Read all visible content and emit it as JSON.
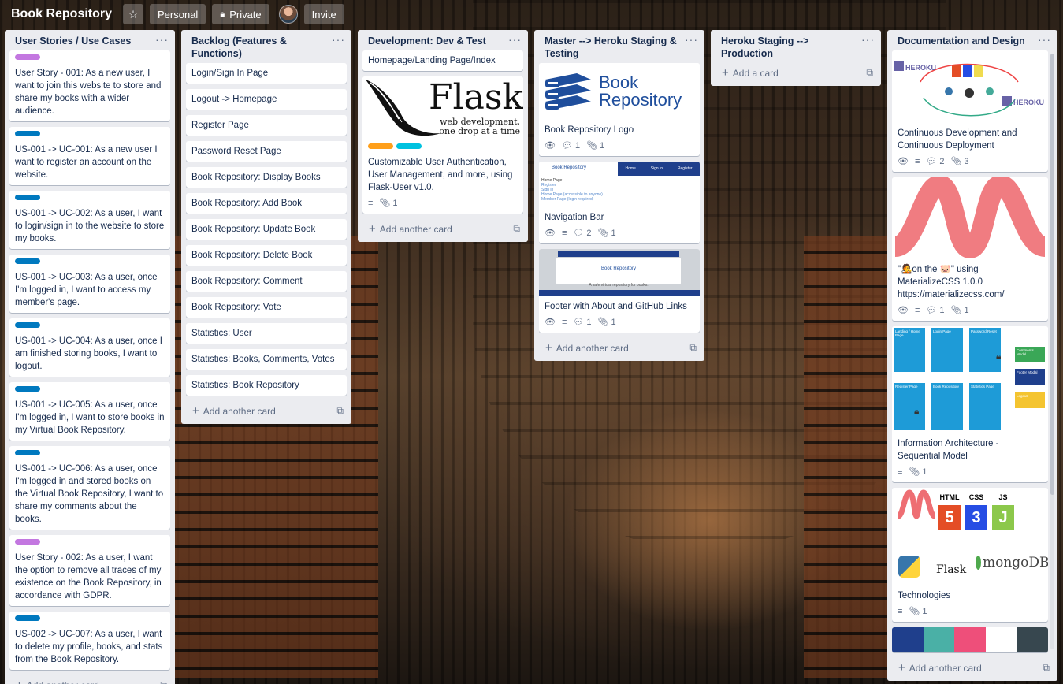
{
  "board": {
    "title": "Book Repository",
    "personal_label": "Personal",
    "private_label": "Private",
    "invite_label": "Invite"
  },
  "add_card_label": "Add another card",
  "add_card_empty_label": "Add a card",
  "colors": {
    "purple": "#c377e0",
    "blue": "#0079bf",
    "orange": "#ff9f1a",
    "cyan": "#00c2e0"
  },
  "lists": [
    {
      "title": "User Stories / Use Cases",
      "cards": [
        {
          "label": "purple",
          "text": "User Story - 001: As a new user, I want to join this website to store and share my books with a wider audience."
        },
        {
          "label": "blue",
          "text": "US-001 -> UC-001: As a new user I want to register an account on the website."
        },
        {
          "label": "blue",
          "text": "US-001 -> UC-002: As a user, I want to login/sign in to the website to store my books."
        },
        {
          "label": "blue",
          "text": "US-001 -> UC-003: As a user, once I'm logged in, I want to access my member's page."
        },
        {
          "label": "blue",
          "text": "US-001 -> UC-004: As a user, once I am finished storing books, I want to logout."
        },
        {
          "label": "blue",
          "text": "US-001 -> UC-005: As a user, once I'm logged in, I want to store books in my Virtual Book Repository."
        },
        {
          "label": "blue",
          "text": "US-001 -> UC-006: As a user, once I'm logged in and stored books on the Virtual Book Repository, I want to share my comments about the books."
        },
        {
          "label": "purple",
          "text": "User Story - 002: As a user, I want the option to remove all traces of my existence on the Book Repository, in accordance with GDPR."
        },
        {
          "label": "blue",
          "text": "US-002 -> UC-007: As a user, I want to delete my profile, books, and stats from the Book Repository."
        }
      ]
    },
    {
      "title": "Backlog (Features & Functions)",
      "cards": [
        "Login/Sign In Page",
        "Logout -> Homepage",
        "Register Page",
        "Password Reset Page",
        "Book Repository: Display Books",
        "Book Repository: Add Book",
        "Book Repository: Update Book",
        "Book Repository: Delete Book",
        "Book Repository: Comment",
        "Book Repository: Vote",
        "Statistics: User",
        "Statistics: Books, Comments, Votes",
        "Statistics: Book Repository"
      ]
    },
    {
      "title": "Development: Dev & Test",
      "card1": "Homepage/Landing Page/Index",
      "flask_word": "Flask",
      "flask_tag1": "web development,",
      "flask_tag2": "one drop at a time",
      "card2": "Customizable User Authentication, User Management, and more, using Flask-User v1.0.",
      "card2_attach": "1"
    },
    {
      "title": "Master --> Heroku Staging & Testing",
      "logo_line1": "Book",
      "logo_line2": "Repository",
      "card1": "Book Repository Logo",
      "card1_comments": "1",
      "card1_attach": "1",
      "nav_brand": "Book Repository",
      "nav_home": "Home",
      "nav_signin": "Sign in",
      "nav_register": "Register",
      "nav_page_lines": [
        "Home Page",
        "Register",
        "Sign in",
        "Home Page (accessible to anyone)",
        "Member Page (login required)"
      ],
      "card2": "Navigation Bar",
      "card2_comments": "2",
      "card2_attach": "1",
      "footer_shot_brand": "Book Repository",
      "footer_shot_tagline": "A safe virtual repository for books.",
      "card3": "Footer with About and GitHub Links",
      "card3_comments": "1",
      "card3_attach": "1"
    },
    {
      "title": "Heroku Staging  --> Production"
    },
    {
      "title": "Documentation and Design",
      "heroku": "HEROKU",
      "card1": "Continuous Development and Continuous Deployment",
      "card1_comments": "2",
      "card1_attach": "3",
      "card2_line1": "\"🧑‍🎤on the 🐷\" using",
      "card2_line2": "MaterializeCSS 1.0.0",
      "card2_line3": "https://materializecss.com/",
      "card2_comments": "1",
      "card2_attach": "1",
      "ia_boxes": [
        "Landing / Home Page",
        "Login Page",
        "Password Reset",
        "Register Page",
        "Book Repository",
        "Statistics Page"
      ],
      "ia_side": [
        "Comments Model",
        "Footer Modal",
        "Logout"
      ],
      "card3": "Information Architecture - Sequential Model",
      "card3_attach": "1",
      "tech_html": "HTML",
      "tech_css": "CSS",
      "tech_js": "JS",
      "tech_flask": "Flask",
      "tech_mongo": "mongoDB",
      "card4": "Technologies",
      "card4_attach": "1"
    }
  ]
}
